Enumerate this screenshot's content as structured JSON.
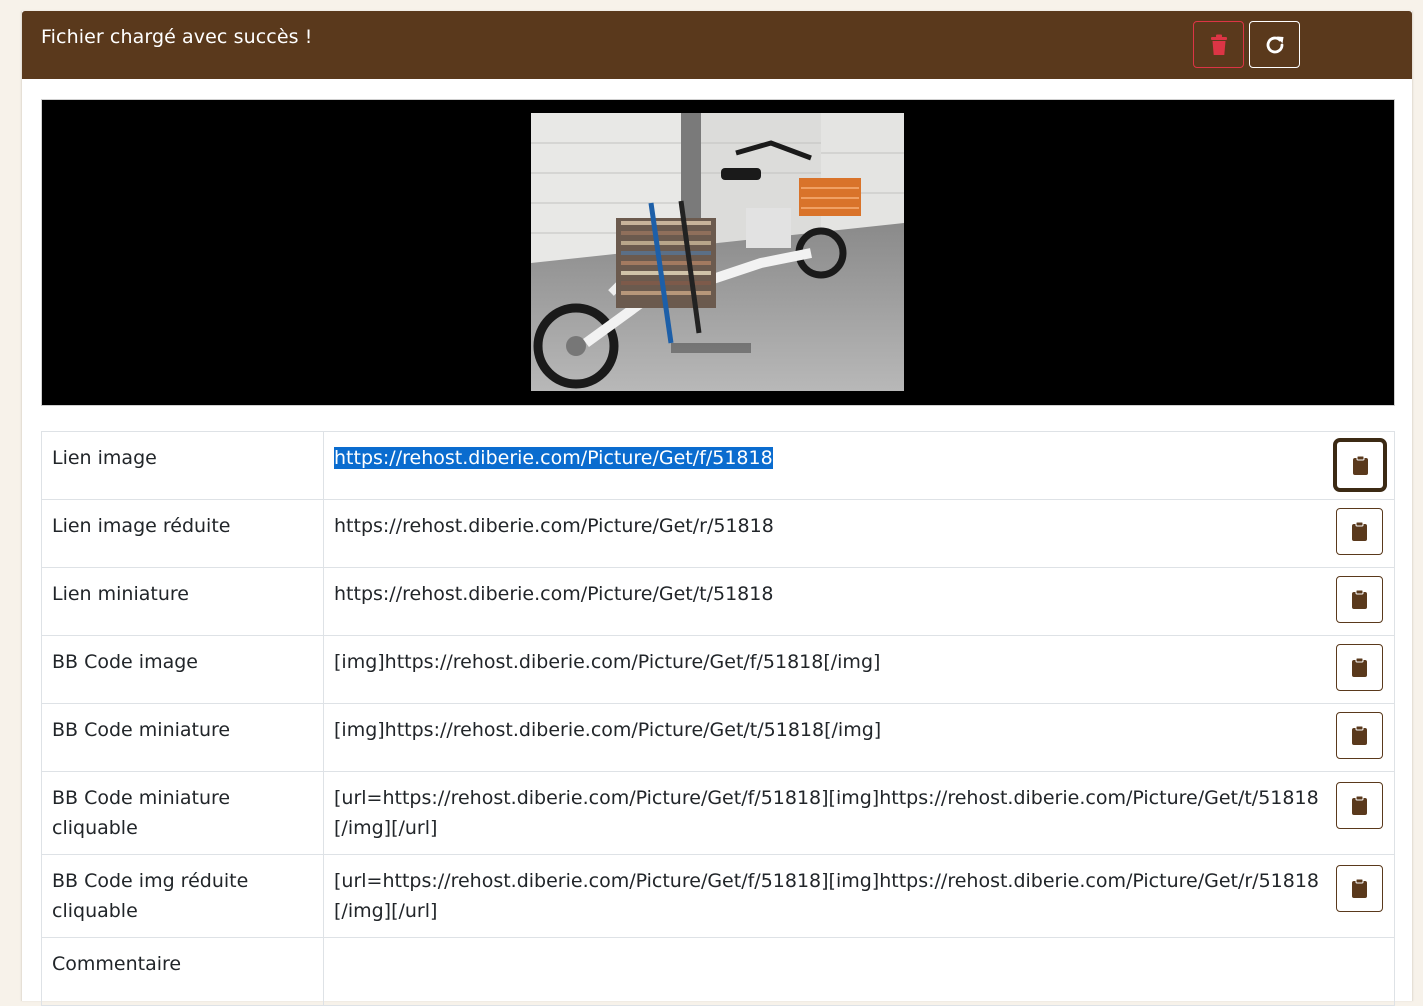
{
  "header": {
    "title": "Fichier chargé avec succès !",
    "delete_icon": "trash-icon",
    "refresh_icon": "refresh-icon"
  },
  "colors": {
    "brand": "#5a391c",
    "danger": "#dc3545",
    "selection": "#0a6ccf"
  },
  "preview": {
    "subject": "cargo e-bike photo"
  },
  "rows": [
    {
      "label": "Lien image",
      "value": "https://rehost.diberie.com/Picture/Get/f/51818",
      "button_icon": "clipboard-icon"
    },
    {
      "label": "Lien image réduite",
      "value": "https://rehost.diberie.com/Picture/Get/r/51818",
      "button_icon": "clipboard-icon"
    },
    {
      "label": "Lien miniature",
      "value": "https://rehost.diberie.com/Picture/Get/t/51818",
      "button_icon": "clipboard-icon"
    },
    {
      "label": "BB Code image",
      "value": "[img]https://rehost.diberie.com/Picture/Get/f/51818[/img]",
      "button_icon": "clipboard-icon"
    },
    {
      "label": "BB Code miniature",
      "value": "[img]https://rehost.diberie.com/Picture/Get/t/51818[/img]",
      "button_icon": "clipboard-icon"
    },
    {
      "label": "BB Code miniature cliquable",
      "value": "[url=https://rehost.diberie.com/Picture/Get/f/51818][img]https://rehost.diberie.com/Picture/Get/t/51818[/img][/url]",
      "button_icon": "clipboard-icon"
    },
    {
      "label": "BB Code img réduite cliquable",
      "value": "[url=https://rehost.diberie.com/Picture/Get/f/51818][img]https://rehost.diberie.com/Picture/Get/r/51818[/img][/url]",
      "button_icon": "clipboard-icon"
    },
    {
      "label": "Commentaire",
      "value": ""
    }
  ]
}
